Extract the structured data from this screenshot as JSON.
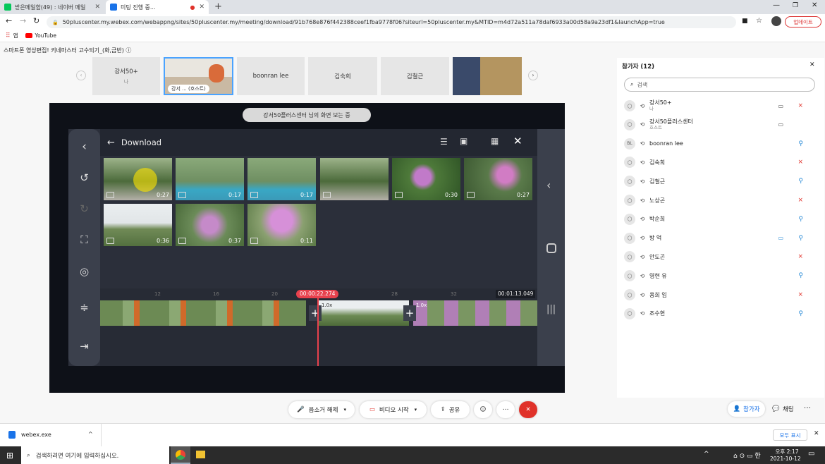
{
  "browser": {
    "tabs": [
      {
        "title": "받은메일함(49) : 네이버 메일",
        "fav_color": "#03c75a"
      },
      {
        "title": "미팅 진행 중...",
        "fav_color": "#1a73e8"
      }
    ],
    "url": "50pluscenter.my.webex.com/webappng/sites/50pluscenter.my/meeting/download/91b768e876f442388ceef1fba9778f06?siteurl=50pluscenter.my&MTID=m4d72a511a78daf6933a00d58a9a23df1&launchApp=true",
    "profile_button": "업데이트",
    "bookmarks": [
      "앱",
      "YouTube"
    ]
  },
  "meeting": {
    "title": "스마트폰 영상편집! 키네마스터 고수되기_(화,금반)",
    "thumbs": [
      {
        "name": "강서50+",
        "sub": "나"
      },
      {
        "name": "강서 ... (호스트)",
        "sub": ""
      },
      {
        "name": "boonran lee",
        "sub": ""
      },
      {
        "name": "김숙희",
        "sub": ""
      },
      {
        "name": "김철근",
        "sub": ""
      }
    ],
    "share_banner": "강서50플러스센터 님의 화면 보는 중"
  },
  "app": {
    "header_title": "Download",
    "clip_durations": [
      "0:27",
      "0:17",
      "0:17",
      "",
      "0:30",
      "0:27",
      "0:36",
      "0:37",
      "0:11"
    ],
    "timeline": {
      "ticks": [
        "12",
        "16",
        "20",
        "24",
        "28",
        "32"
      ],
      "current_time": "00:00:22.274",
      "total_time": "00:01:13.049",
      "seg_labels": [
        "1.0x",
        "1.0x"
      ]
    }
  },
  "controls": {
    "unmute": "음소거 해제",
    "video": "비디오 시작",
    "share": "공유",
    "participants_btn": "참가자",
    "chat_btn": "채팅"
  },
  "panel": {
    "title": "참가자 (12)",
    "search_placeholder": "검색",
    "participants": [
      {
        "name": "강서50+",
        "sub": "나",
        "mic": "off",
        "cam": true
      },
      {
        "name": "강서50플러스센터",
        "sub": "호스트",
        "mic": "none",
        "cam": true
      },
      {
        "name": "boonran lee",
        "sub": "",
        "mic": "on",
        "cam": false,
        "initials": "BL"
      },
      {
        "name": "김숙희",
        "sub": "",
        "mic": "off",
        "cam": false
      },
      {
        "name": "김철근",
        "sub": "",
        "mic": "on",
        "cam": false
      },
      {
        "name": "노상곤",
        "sub": "",
        "mic": "off",
        "cam": false
      },
      {
        "name": "박순희",
        "sub": "",
        "mic": "on",
        "cam": false
      },
      {
        "name": "방 억",
        "sub": "",
        "mic": "on",
        "cam": true
      },
      {
        "name": "안도곤",
        "sub": "",
        "mic": "off",
        "cam": false
      },
      {
        "name": "영현 유",
        "sub": "",
        "mic": "on",
        "cam": false
      },
      {
        "name": "용희 임",
        "sub": "",
        "mic": "off",
        "cam": false
      },
      {
        "name": "조수현",
        "sub": "",
        "mic": "on",
        "cam": false
      }
    ]
  },
  "download_shelf": {
    "file": "webex.exe",
    "show_all": "모두 표시"
  },
  "taskbar": {
    "search": "검색하려면 여기에 입력하십시오.",
    "time": "오후 2:17",
    "date": "2021-10-12"
  },
  "colors": {
    "webex_blue": "#1a73e8",
    "end_red": "#e0322a",
    "mic_off": "#e0322a",
    "mic_on": "#2a8bd6",
    "time_red": "#e8414d"
  }
}
